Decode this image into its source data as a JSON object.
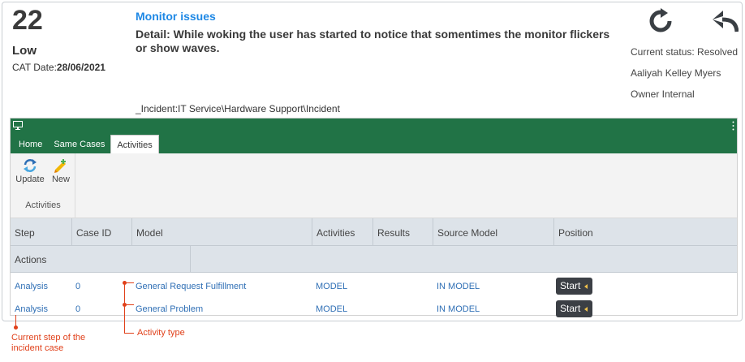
{
  "case": {
    "number": "22",
    "priority": "Low",
    "cat_date_label": "CAT Date:",
    "cat_date_value": "28/06/2021",
    "title": "Monitor issues",
    "detail": "Detail: While woking the user has started to notice that somentimes the monitor flickers or show waves.",
    "path": "_Incident:IT Service\\Hardware Support\\Incident",
    "status": "Current status: Resolved",
    "owner_name": "Aaliyah Kelley Myers",
    "owner_group": "Owner Internal"
  },
  "icons": {
    "refresh": "refresh-icon",
    "reply": "reply-icon",
    "monitor": "monitor-icon",
    "update": "update-icon",
    "new": "new-icon"
  },
  "tabs": [
    {
      "label": "Home",
      "active": false
    },
    {
      "label": "Same Cases",
      "active": false
    },
    {
      "label": "Activities",
      "active": true
    }
  ],
  "ribbon": {
    "update_label": "Update",
    "new_label": "New",
    "group_label": "Activities"
  },
  "grid": {
    "columns": [
      "Step",
      "Case ID",
      "Model",
      "Activities",
      "Results",
      "Source Model",
      "Position"
    ],
    "actions_label": "Actions",
    "rows": [
      {
        "step": "Analysis",
        "case_id": "0",
        "model": "General Request Fulfillment",
        "activities": "MODEL",
        "results": "",
        "source_model": "IN MODEL",
        "position": "Start"
      },
      {
        "step": "Analysis",
        "case_id": "0",
        "model": "General Problem",
        "activities": "MODEL",
        "results": "",
        "source_model": "IN MODEL",
        "position": "Start"
      }
    ]
  },
  "annotations": {
    "current_step": "Current step of the incident case",
    "activity_type": "Activity type"
  },
  "colors": {
    "accent": "#1e88e5",
    "app_bar": "#217346",
    "annotation": "#e0401a",
    "start_button": "#3b3f45"
  }
}
